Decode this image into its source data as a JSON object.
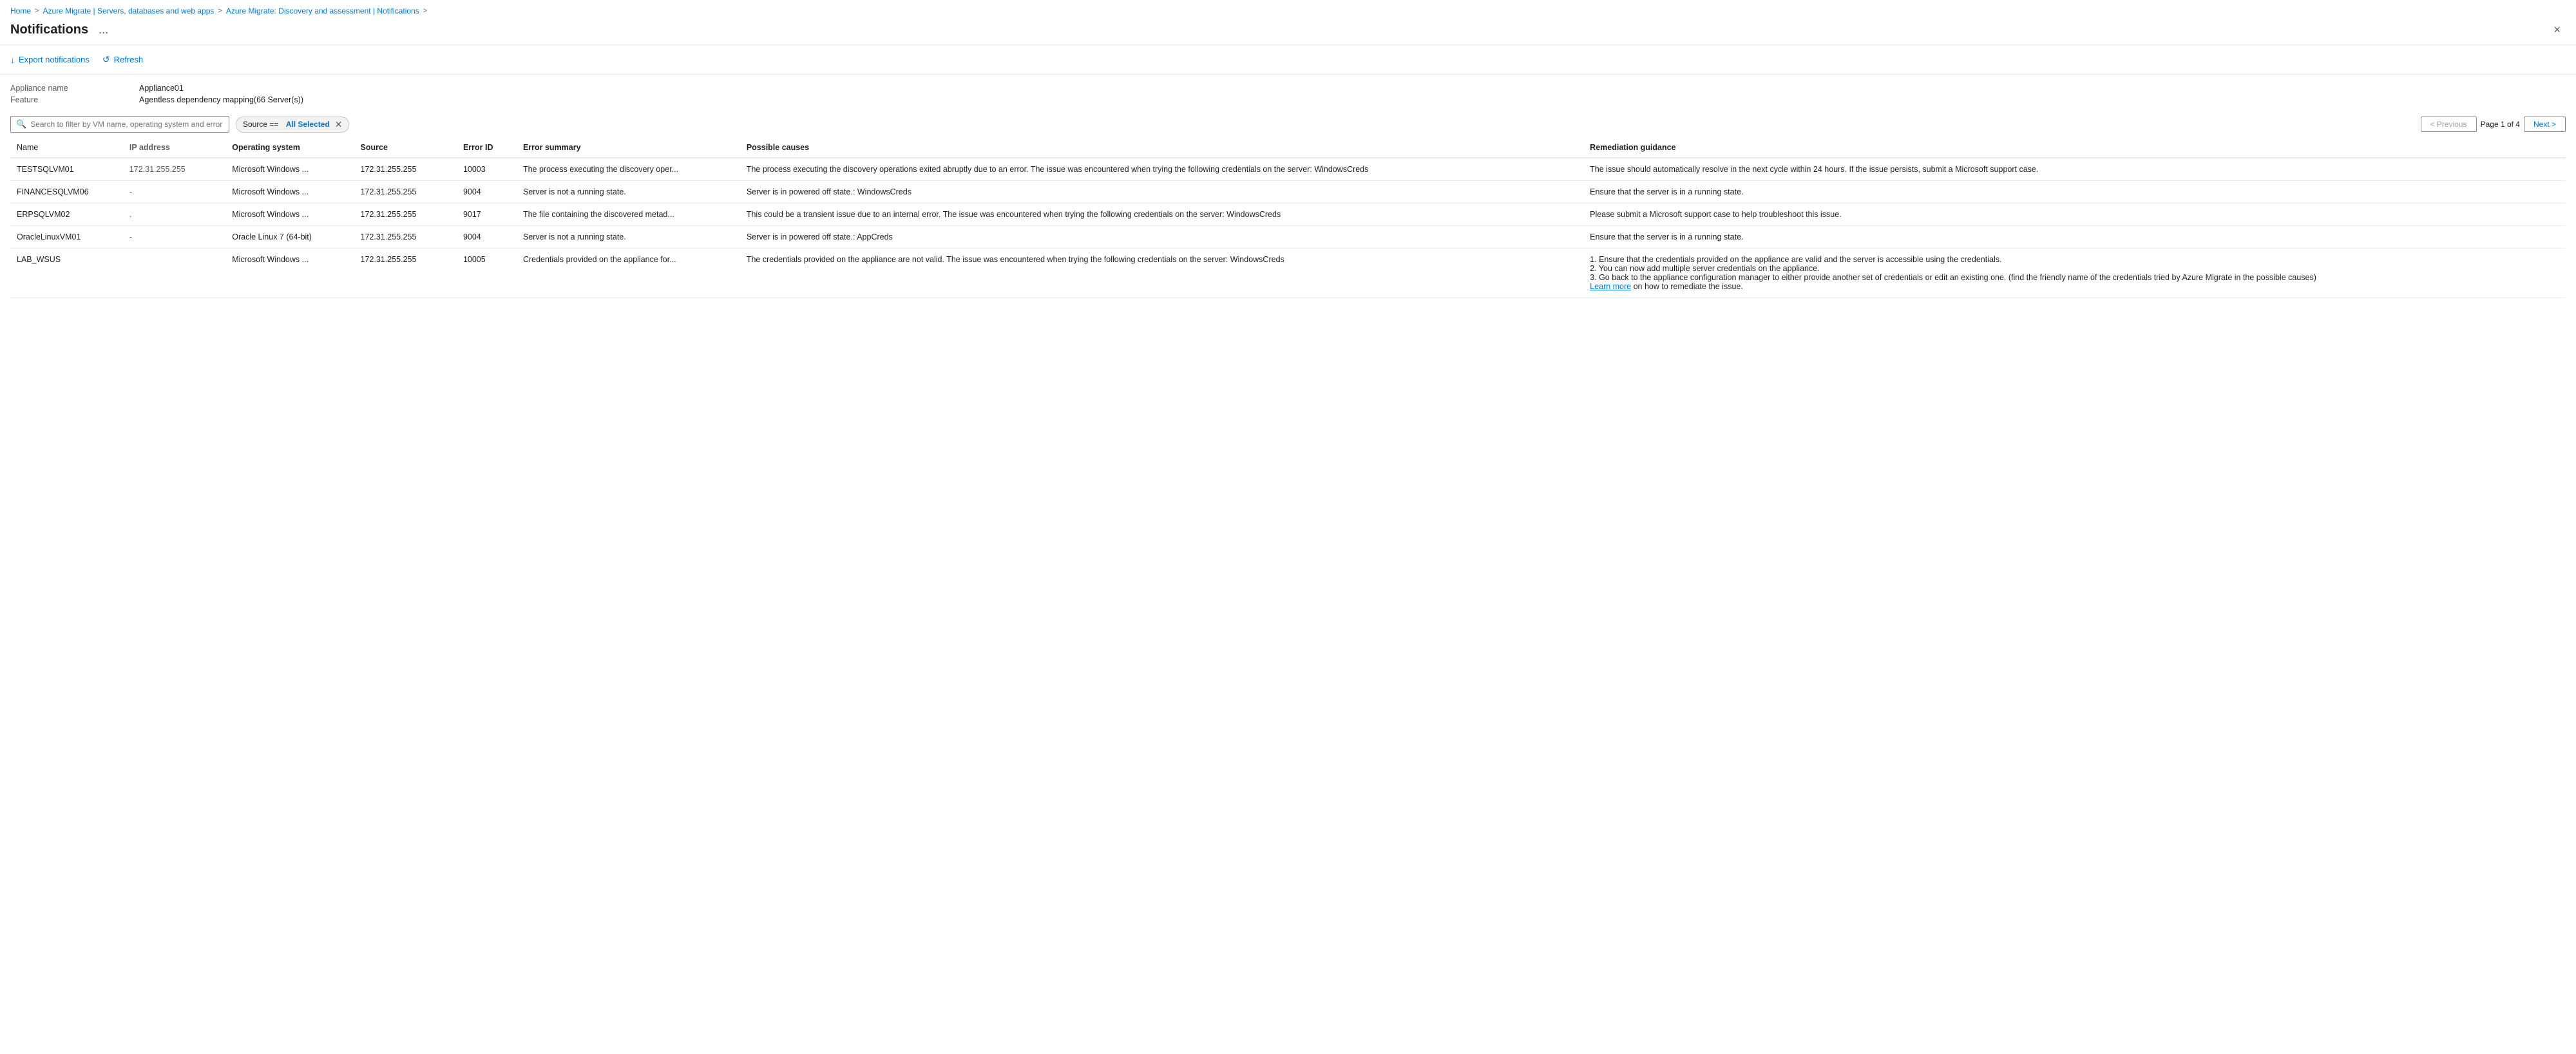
{
  "breadcrumb": {
    "items": [
      {
        "label": "Home",
        "active": true
      },
      {
        "label": "Azure Migrate | Servers, databases and web apps",
        "active": true
      },
      {
        "label": "Azure Migrate: Discovery and assessment | Notifications",
        "active": true
      }
    ],
    "separators": [
      ">",
      ">",
      ">"
    ]
  },
  "header": {
    "title": "Notifications",
    "menu_label": "...",
    "close_label": "×"
  },
  "toolbar": {
    "export_label": "Export notifications",
    "export_icon": "↓",
    "refresh_label": "Refresh",
    "refresh_icon": "↺"
  },
  "info": {
    "appliance_label": "Appliance name",
    "appliance_value": "Appliance01",
    "feature_label": "Feature",
    "feature_value": "Agentless dependency mapping(66 Server(s))"
  },
  "filter": {
    "search_placeholder": "Search to filter by VM name, operating system and error ID",
    "tag_prefix": "Source ==",
    "tag_value": "All Selected"
  },
  "pagination": {
    "previous_label": "< Previous",
    "next_label": "Next >",
    "page_info": "Page 1 of 4"
  },
  "table": {
    "columns": [
      {
        "key": "name",
        "label": "Name"
      },
      {
        "key": "ip",
        "label": "IP address"
      },
      {
        "key": "os",
        "label": "Operating system"
      },
      {
        "key": "source",
        "label": "Source"
      },
      {
        "key": "errorId",
        "label": "Error ID"
      },
      {
        "key": "summary",
        "label": "Error summary"
      },
      {
        "key": "causes",
        "label": "Possible causes"
      },
      {
        "key": "remediation",
        "label": "Remediation guidance"
      }
    ],
    "rows": [
      {
        "name": "TESTSQLVM01",
        "ip": "172.31.255.255",
        "os": "Microsoft Windows ...",
        "source": "172.31.255.255",
        "errorId": "10003",
        "summary": "The process executing the discovery oper...",
        "causes": "The process executing the discovery operations exited abruptly due to an error. The issue was encountered when trying the following credentials on the server: WindowsCreds",
        "remediation": "The issue should automatically resolve in the next cycle within 24 hours. If the issue persists, submit a Microsoft support case."
      },
      {
        "name": "FINANCESQLVM06",
        "ip": "-",
        "os": "Microsoft Windows ...",
        "source": "172.31.255.255",
        "errorId": "9004",
        "summary": "Server is not a running state.",
        "causes": "Server is in powered off state.: WindowsCreds",
        "remediation": "Ensure that the server is in a running state."
      },
      {
        "name": "ERPSQLVM02",
        "ip": ".",
        "os": "Microsoft Windows ...",
        "source": "172.31.255.255",
        "errorId": "9017",
        "summary": "The file containing the discovered metad...",
        "causes": "This could be a transient issue due to an internal error. The issue was encountered when trying the following credentials on the server: WindowsCreds",
        "remediation": "Please submit a Microsoft support case to help troubleshoot this issue."
      },
      {
        "name": "OracleLinuxVM01",
        "ip": "-",
        "os": "Oracle Linux 7 (64-bit)",
        "source": "172.31.255.255",
        "errorId": "9004",
        "summary": "Server is not a running state.",
        "causes": "Server is in powered off state.: AppCreds",
        "remediation": "Ensure that the server is in a running state."
      },
      {
        "name": "LAB_WSUS",
        "ip": "",
        "os": "Microsoft Windows ...",
        "source": "172.31.255.255",
        "errorId": "10005",
        "summary": "Credentials provided on the appliance for...",
        "causes": "The credentials provided on the appliance are not valid. The issue was encountered when trying the following credentials on the server: WindowsCreds",
        "remediation": "1. Ensure that the credentials provided on the appliance are valid and the server is accessible using the credentials.\n2. You can now add multiple server credentials on the appliance.\n3. Go back to the appliance configuration manager to either provide another set of credentials or edit an existing one. (find the friendly name of the credentials tried by Azure Migrate in the possible causes)",
        "remediation_link": "Learn more",
        "remediation_link_suffix": " on how to remediate the issue."
      }
    ]
  }
}
